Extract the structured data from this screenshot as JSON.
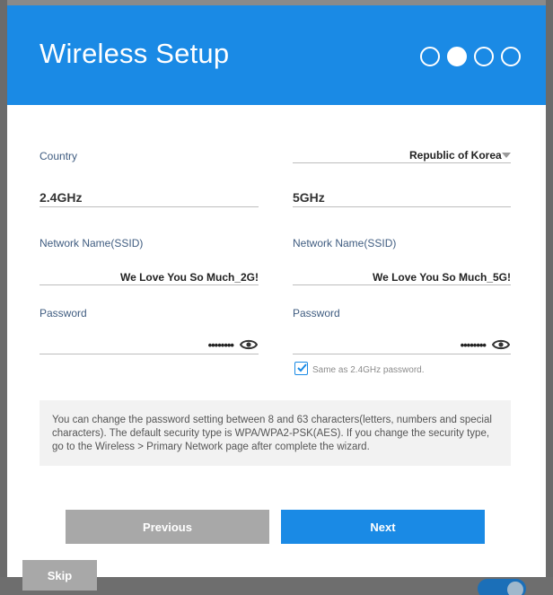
{
  "dialog": {
    "title": "Wireless Setup",
    "steps": [
      false,
      true,
      false,
      false
    ]
  },
  "country": {
    "label": "Country",
    "value": "Republic of Korea"
  },
  "band_24": {
    "title": "2.4GHz",
    "ssid_label": "Network Name(SSID)",
    "ssid_value": "We Love You So Much_2G!",
    "password_label": "Password",
    "password_value": "••••••••"
  },
  "band_5": {
    "title": "5GHz",
    "ssid_label": "Network Name(SSID)",
    "ssid_value": "We Love You So Much_5G!",
    "password_label": "Password",
    "password_value": "••••••••",
    "same_password_label": "Same as 2.4GHz password.",
    "same_password_checked": true
  },
  "info_text": "You can change the password setting between 8 and 63 characters(letters, numbers and special characters). The default security type is WPA/WPA2-PSK(AES). If you change the security type, go to the Wireless > Primary Network page after complete the wizard.",
  "buttons": {
    "previous": "Previous",
    "next": "Next",
    "skip": "Skip"
  },
  "colors": {
    "accent": "#1a8ae5",
    "disabled": "#a8a8a8"
  }
}
